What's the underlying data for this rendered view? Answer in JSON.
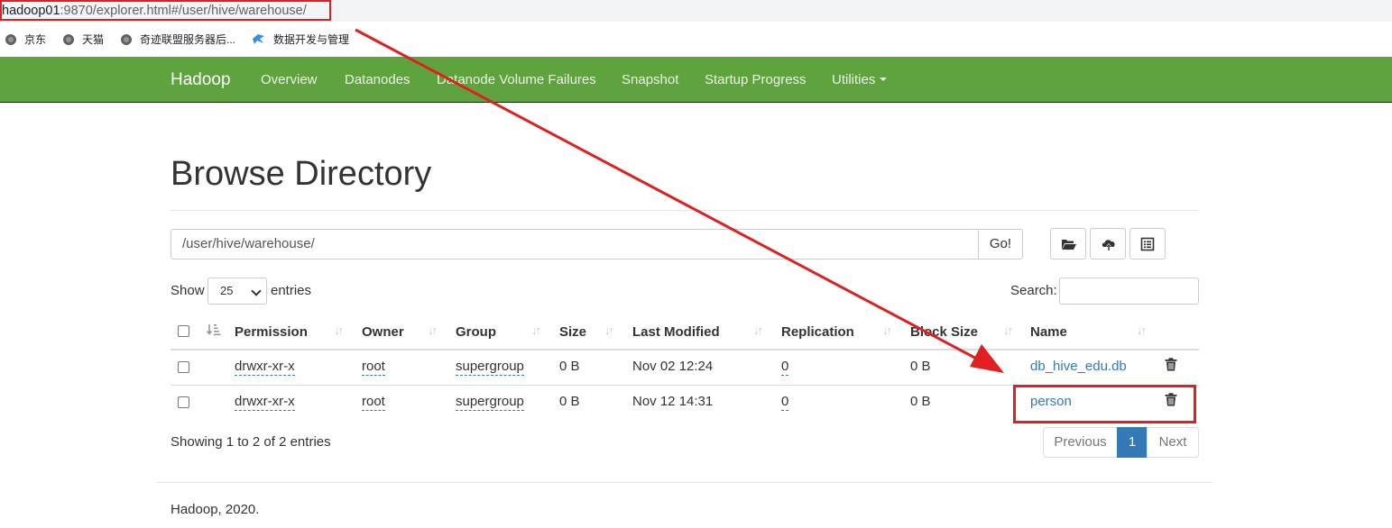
{
  "address_bar": {
    "host": "hadoop01",
    "rest": ":9870/explorer.html#/user/hive/warehouse/"
  },
  "bookmarks": [
    "京东",
    "天猫",
    "奇迹联盟服务器后...",
    "数据开发与管理"
  ],
  "navbar": {
    "brand": "Hadoop",
    "links": [
      "Overview",
      "Datanodes",
      "Datanode Volume Failures",
      "Snapshot",
      "Startup Progress",
      "Utilities"
    ]
  },
  "page": {
    "title": "Browse Directory",
    "path_value": "/user/hive/warehouse/",
    "go_label": "Go!",
    "show_label": "Show",
    "entries_select": "25",
    "entries_label": "entries",
    "search_label": "Search:"
  },
  "table": {
    "headers": [
      "Permission",
      "Owner",
      "Group",
      "Size",
      "Last Modified",
      "Replication",
      "Block Size",
      "Name"
    ],
    "rows": [
      {
        "permission": "drwxr-xr-x",
        "owner": "root",
        "group": "supergroup",
        "size": "0 B",
        "modified": "Nov 02 12:24",
        "replication": "0",
        "block_size": "0 B",
        "name": "db_hive_edu.db"
      },
      {
        "permission": "drwxr-xr-x",
        "owner": "root",
        "group": "supergroup",
        "size": "0 B",
        "modified": "Nov 12 14:31",
        "replication": "0",
        "block_size": "0 B",
        "name": "person"
      }
    ]
  },
  "footer_info": "Showing 1 to 2 of 2 entries",
  "pagination": {
    "previous": "Previous",
    "current": "1",
    "next": "Next"
  },
  "footer": "Hadoop, 2020.",
  "colors": {
    "navbar": "#5fa33e",
    "link": "#337ab7",
    "annotation": "#e02020"
  }
}
